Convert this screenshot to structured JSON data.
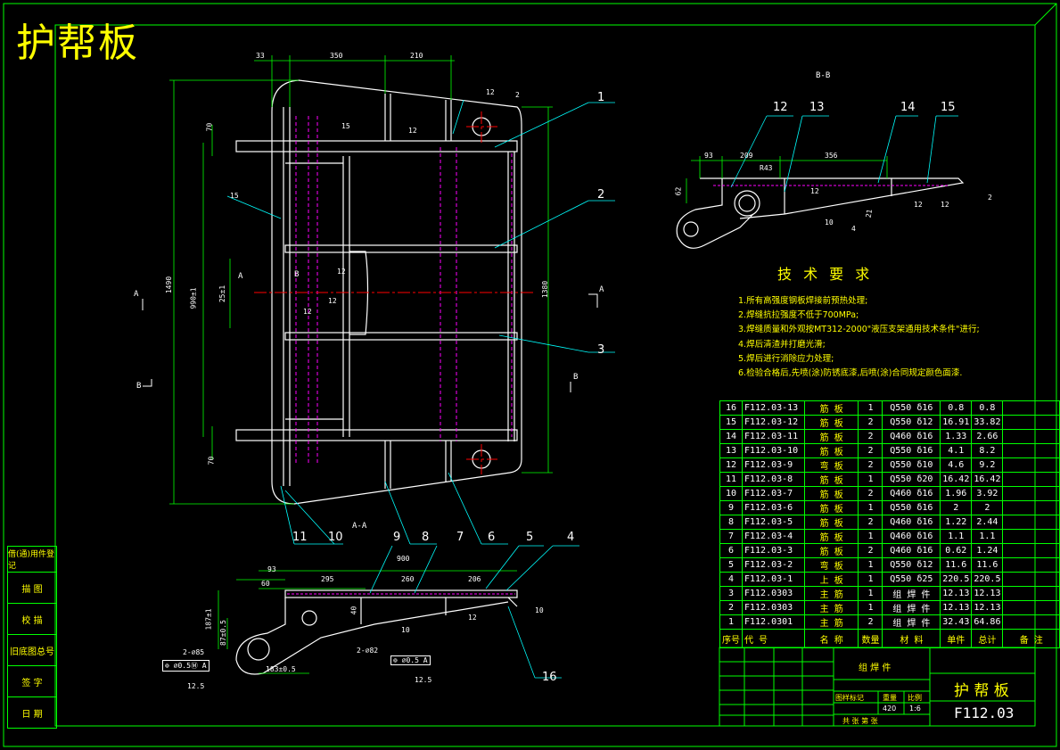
{
  "title": "护帮板",
  "section_labels": {
    "bb": "B-B",
    "aa": "A-A",
    "a_left": "A",
    "a_right": "A",
    "b_left": "B",
    "b_right": "B",
    "mark_a": "A",
    "mark_b": "B"
  },
  "dimensions": {
    "top_33": "33",
    "top_350": "350",
    "top_210": "210",
    "h_1490": "1490",
    "h_990": "990±1",
    "h_1380": "1380",
    "h_70_top": "70",
    "h_70_bot": "70",
    "h_25": "25±1",
    "bb_93": "93",
    "bb_209": "209",
    "bb_356": "356",
    "bb_r43": "R43",
    "bb_62": "62",
    "bb_21": "21",
    "aa_93": "93",
    "aa_60": "60",
    "aa_900": "900",
    "aa_295": "295",
    "aa_260": "260",
    "aa_206": "206",
    "aa_40": "40",
    "aa_187": "187±1",
    "aa_87": "87±0.5",
    "aa_183": "183±0.5",
    "aa_tol1": "⊚ ∅0.5Ⓜ A",
    "aa_tol2": "⊚ ∅0.5 A",
    "aa_hole1": "2-∅85",
    "aa_hole2": "2-∅82",
    "rough1": "12.5",
    "rough2": "12.5"
  },
  "welds": [
    "12",
    "15",
    "12",
    "12",
    "12",
    "12",
    "15",
    "12",
    "12",
    "10",
    "4",
    "12",
    "10",
    "12",
    "10",
    "2",
    "2"
  ],
  "callouts": [
    "1",
    "2",
    "3",
    "4",
    "5",
    "6",
    "7",
    "8",
    "9",
    "10",
    "11",
    "12",
    "13",
    "14",
    "15",
    "16"
  ],
  "tech": {
    "title": "技 术 要 求",
    "items": [
      "1.所有高强度钢板焊接前预热处理;",
      "2.焊缝抗拉强度不低于700MPa;",
      "3.焊缝质量和外观按MT312-2000\"液压支架通用技术条件\"进行;",
      "4.焊后清渣并打磨光滑;",
      "5.焊后进行消除应力处理;",
      "6.检验合格后,先喷(涂)防锈底漆,后喷(涂)合同规定颜色面漆."
    ]
  },
  "bom": {
    "rows": [
      [
        "16",
        "F112.03-13",
        "筋 板",
        "1",
        "Q550 δ16",
        "0.8",
        "0.8",
        ""
      ],
      [
        "15",
        "F112.03-12",
        "筋 板",
        "2",
        "Q550 δ12",
        "16.91",
        "33.82",
        ""
      ],
      [
        "14",
        "F112.03-11",
        "筋 板",
        "2",
        "Q460 δ16",
        "1.33",
        "2.66",
        ""
      ],
      [
        "13",
        "F112.03-10",
        "筋 板",
        "2",
        "Q550 δ16",
        "4.1",
        "8.2",
        ""
      ],
      [
        "12",
        "F112.03-9",
        "弯 板",
        "2",
        "Q550 δ10",
        "4.6",
        "9.2",
        ""
      ],
      [
        "11",
        "F112.03-8",
        "筋 板",
        "1",
        "Q550 δ20",
        "16.42",
        "16.42",
        ""
      ],
      [
        "10",
        "F112.03-7",
        "筋 板",
        "2",
        "Q460 δ16",
        "1.96",
        "3.92",
        ""
      ],
      [
        "9",
        "F112.03-6",
        "筋 板",
        "1",
        "Q550 δ16",
        "2",
        "2",
        ""
      ],
      [
        "8",
        "F112.03-5",
        "筋 板",
        "2",
        "Q460 δ16",
        "1.22",
        "2.44",
        ""
      ],
      [
        "7",
        "F112.03-4",
        "筋 板",
        "1",
        "Q460 δ16",
        "1.1",
        "1.1",
        ""
      ],
      [
        "6",
        "F112.03-3",
        "筋 板",
        "2",
        "Q460 δ16",
        "0.62",
        "1.24",
        ""
      ],
      [
        "5",
        "F112.03-2",
        "弯 板",
        "1",
        "Q550 δ12",
        "11.6",
        "11.6",
        ""
      ],
      [
        "4",
        "F112.03-1",
        "上 板",
        "1",
        "Q550 δ25",
        "220.5",
        "220.5",
        ""
      ],
      [
        "3",
        "F112.0303",
        "主 筋",
        "1",
        "组 焊 件",
        "12.13",
        "12.13",
        ""
      ],
      [
        "2",
        "F112.0303",
        "主 筋",
        "1",
        "组 焊 件",
        "12.13",
        "12.13",
        ""
      ],
      [
        "1",
        "F112.0301",
        "主 筋",
        "2",
        "组 焊 件",
        "32.43",
        "64.86",
        ""
      ]
    ],
    "header": [
      "序号",
      "代 号",
      "名 称",
      "数量",
      "材 料",
      "单件",
      "总计",
      "备 注"
    ]
  },
  "title_block": {
    "assembly": "组 焊 件",
    "name": "护 帮 板",
    "code": "F112.03",
    "weight": "420",
    "scale": "1:6",
    "stage_label": "图样标记",
    "weight_label": "重量",
    "scale_label": "比例",
    "sheet_label": "共  张  第  张"
  },
  "side_box": [
    "借(通)用件登记",
    "描 图",
    "校 描",
    "旧底图总号",
    "签 字",
    "日 期"
  ],
  "colors": {
    "frame": "#00ff00",
    "part": "#ffffff",
    "centerline": "#ff0000",
    "hidden": "#ff00ff",
    "leader": "#00ffff",
    "text_yellow": "#ffff00"
  }
}
